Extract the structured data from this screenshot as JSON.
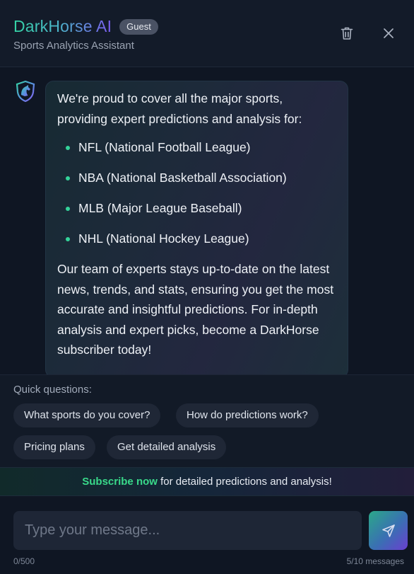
{
  "header": {
    "brand": "DarkHorse AI",
    "badge": "Guest",
    "subtitle": "Sports Analytics Assistant",
    "trash_icon": "trash-icon",
    "close_icon": "close-icon"
  },
  "message": {
    "avatar_icon": "horse-shield-logo",
    "intro": "We're proud to cover all the major sports, providing expert predictions and analysis for:",
    "list": [
      "NFL (National Football League)",
      "NBA (National Basketball Association)",
      "MLB (Major League Baseball)",
      "NHL (National Hockey League)"
    ],
    "outro": "Our team of experts stays up-to-date on the latest news, trends, and stats, ensuring you get the most accurate and insightful predictions. For in-depth analysis and expert picks, become a DarkHorse subscriber today!"
  },
  "quick_questions": {
    "label": "Quick questions:",
    "chips": [
      "What sports do you cover?",
      "How do predictions work?",
      "Pricing plans",
      "Get detailed analysis"
    ]
  },
  "banner": {
    "link": "Subscribe now",
    "text": " for detailed predictions and analysis!"
  },
  "input": {
    "placeholder": "Type your message...",
    "value": "",
    "char_count": "0/500",
    "message_count": "5/10 messages",
    "send_icon": "send-icon"
  },
  "colors": {
    "accent_green": "#34d39a",
    "accent_purple": "#7b5cf0",
    "background": "#0f1623"
  }
}
